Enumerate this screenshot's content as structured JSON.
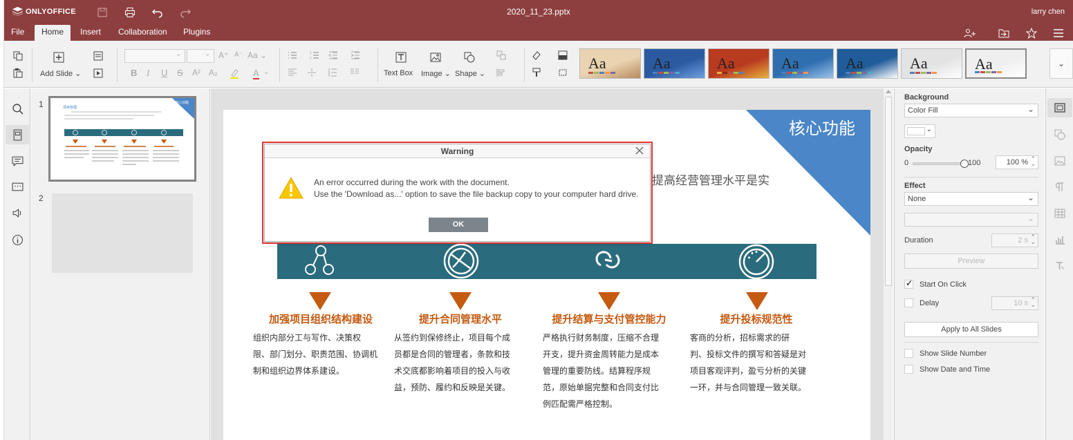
{
  "app": {
    "name": "ONLYOFFICE",
    "file_title": "2020_11_23.pptx",
    "user": "larry chen"
  },
  "menu": {
    "tabs": [
      "File",
      "Home",
      "Insert",
      "Collaboration",
      "Plugins"
    ],
    "active": "Home"
  },
  "toolbar": {
    "add_slide": "Add Slide",
    "text_box": "Text Box",
    "image": "Image",
    "shape": "Shape",
    "font_grow": "A",
    "font_shrink": "A",
    "change_case": "Aa",
    "bold": "B",
    "italic": "I",
    "underline": "U",
    "strike": "S",
    "superscript": "A²",
    "subscript": "A₂",
    "font_color": "A",
    "theme_label": "Aa"
  },
  "themes": [
    {
      "bg": "#e9d3b0",
      "accent": "#b78a5d",
      "bars": [
        "#c0504d",
        "#9bbb59",
        "#4f81bd",
        "#f79646",
        "#8064a2"
      ]
    },
    {
      "bg": "#2b5aa1",
      "accent": "#6fa0e0",
      "bars": [
        "#4f81bd",
        "#c0504d",
        "#9bbb59",
        "#8064a2",
        "#4bacc6"
      ]
    },
    {
      "bg": "#b83a1f",
      "accent": "#e9b23c",
      "bars": [
        "#e9b23c",
        "#8a2d18",
        "#c0504d",
        "#9bbb59",
        "#4f81bd"
      ]
    },
    {
      "bg": "#2f6fb0",
      "accent": "#9cc3ea",
      "bars": [
        "#4f81bd",
        "#c0504d",
        "#9bbb59",
        "#8064a2",
        "#f79646"
      ]
    },
    {
      "bg": "#1f5c99",
      "accent": "#ffffff",
      "bars": [
        "#4f81bd",
        "#c0504d",
        "#9bbb59",
        "#8064a2",
        "#4bacc6"
      ]
    },
    {
      "bg": "#e3e3e3",
      "accent": "#ffffff",
      "bars": [
        "#4f81bd",
        "#c0504d",
        "#9bbb59",
        "#8064a2",
        "#f79646"
      ]
    },
    {
      "bg": "#efefef",
      "accent": "#ffffff",
      "bars": [
        "#4f81bd",
        "#c0504d",
        "#9bbb59",
        "#8064a2",
        "#f79646"
      ]
    }
  ],
  "slides_panel": {
    "numbers": [
      "1",
      "2"
    ]
  },
  "slide": {
    "corner_title": "核心功能",
    "partial_text": "提高经营管理水平是实",
    "columns": [
      {
        "heading": "加强项目组织结构建设",
        "body": [
          "组织内部分工与写作、决策权",
          "限、部门划分、职责范围、协调机",
          "制和组织边界体系建设。"
        ]
      },
      {
        "heading": "提升合同管理水平",
        "body": [
          "从签约到保修终止，项目每个成",
          "员都是合同的管理者，条款和技",
          "术交底都影响着项目的投入与收",
          "益，预防、履约和反映是关键。"
        ]
      },
      {
        "heading": "提升结算与支付管控能力",
        "body": [
          "严格执行财务制度，压缩不合理",
          "开支，提升资金周转能力是成本",
          "管理的重要防线。结算程序规",
          "范，原始单据完整和合同支付比",
          "例匹配需严格控制。"
        ]
      },
      {
        "heading": "提升投标规范性",
        "body": [
          "客商的分析，招标需求的研",
          "判、投标文件的撰写和答疑是对",
          "项目客观评判，盈亏分析的关键",
          "一环，并与合同管理一致关联。"
        ]
      }
    ],
    "colors": {
      "band": "#2a6b7d",
      "accent": "#c55a11",
      "corner": "#4a86c8"
    }
  },
  "thumb1": {
    "corner": "核心功能",
    "title": "项目管理"
  },
  "right_panel": {
    "background_label": "Background",
    "background_value": "Color Fill",
    "opacity_label": "Opacity",
    "opacity_min": "0",
    "opacity_max": "100",
    "opacity_value": "100 %",
    "opacity_fraction": 1.0,
    "effect_label": "Effect",
    "effect_value": "None",
    "duration_label": "Duration",
    "duration_value": "2 s",
    "preview": "Preview",
    "start_on_click": "Start On Click",
    "start_on_click_checked": true,
    "delay": "Delay",
    "delay_checked": false,
    "delay_value": "10 s",
    "apply_all": "Apply to All Slides",
    "show_slide_number": "Show Slide Number",
    "show_date_time": "Show Date and Time"
  },
  "dialog": {
    "title": "Warning",
    "line1": "An error occurred during the work with the document.",
    "line2": "Use the 'Download as...' option to save the file backup copy to your computer hard drive.",
    "ok": "OK",
    "icon": "warning-icon"
  }
}
